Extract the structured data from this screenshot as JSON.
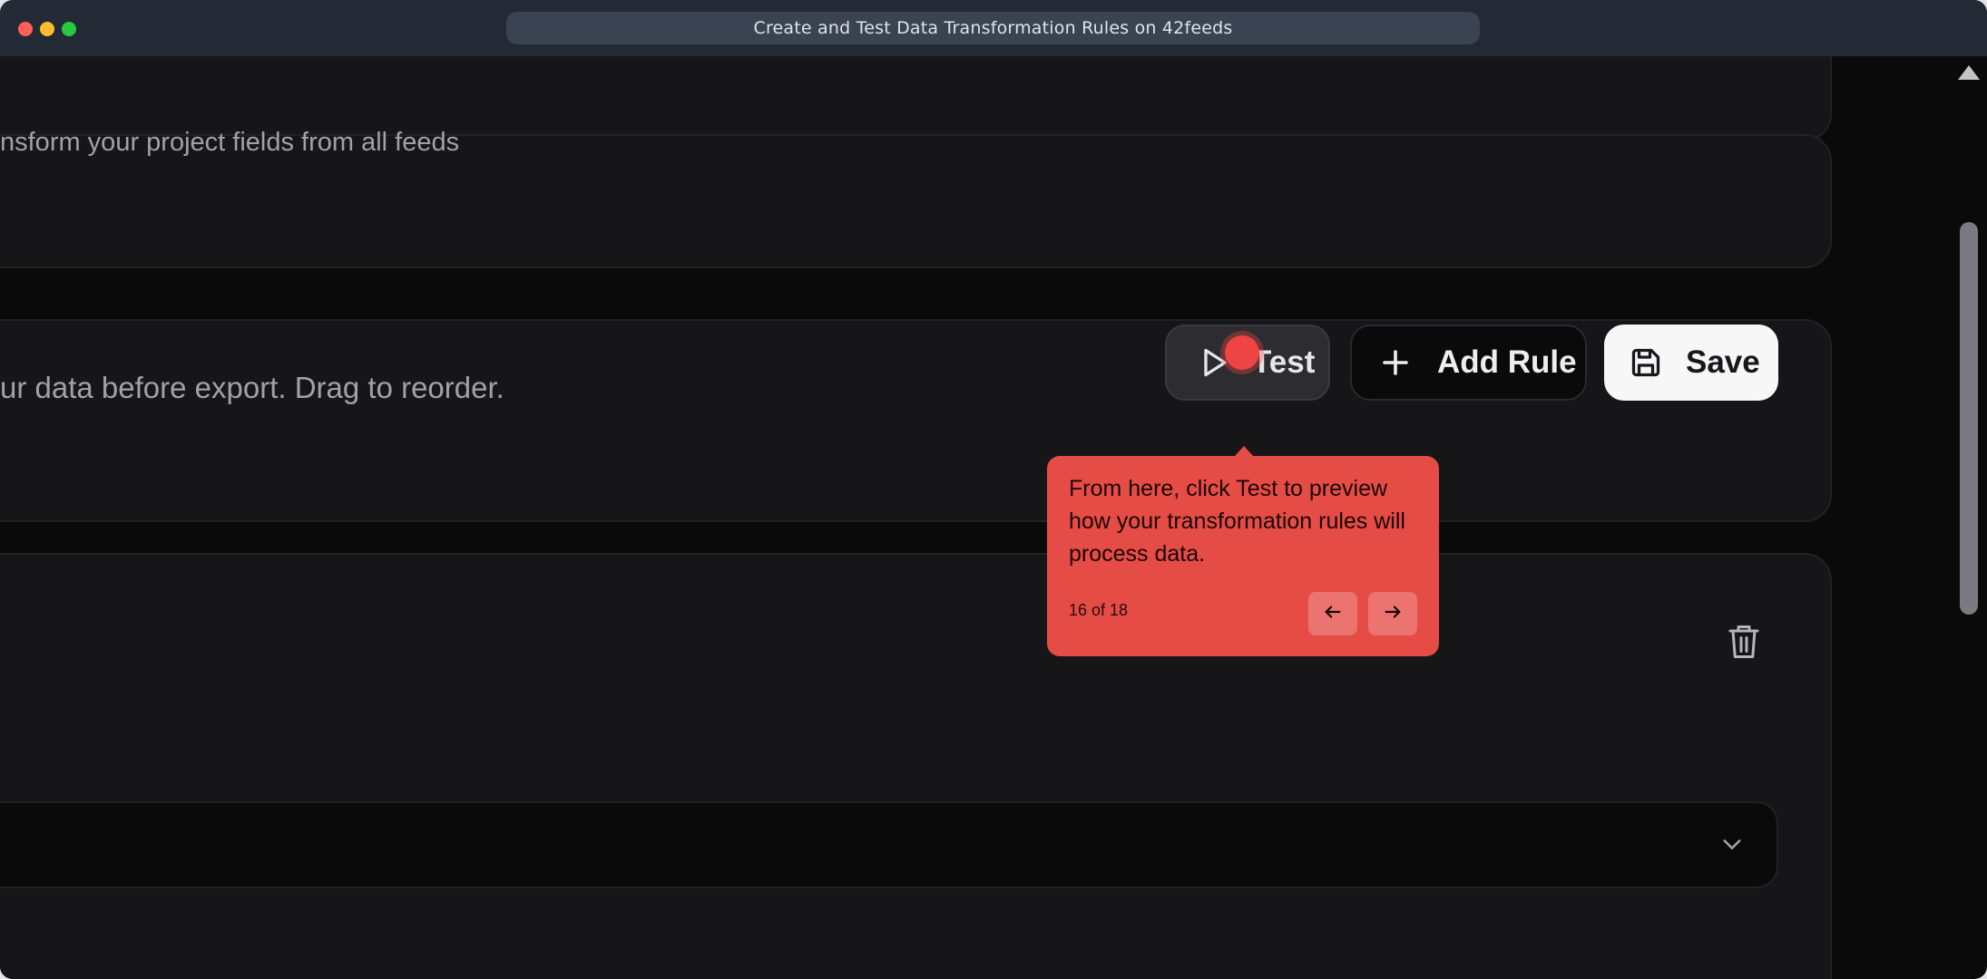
{
  "window": {
    "title": "Create and Test Data Transformation Rules on 42feeds"
  },
  "page": {
    "description_text": "nsform your project fields from all feeds",
    "rules_subtitle": "ur data before export. Drag to reorder."
  },
  "toolbar": {
    "test_label": "Test",
    "add_rule_label": "Add Rule",
    "save_label": "Save"
  },
  "tooltip": {
    "text": "From here, click Test to preview how your transformation rules will process data.",
    "step": "16 of 18"
  },
  "icons": {
    "test": "play-icon",
    "add_rule": "plus-icon",
    "save": "floppy-disk-icon",
    "delete": "trash-icon",
    "dropdown": "chevron-down-icon",
    "prev": "arrow-left-icon",
    "next": "arrow-right-icon"
  },
  "colors": {
    "tooltip_bg": "#e54c46",
    "pulse": "#ef4444",
    "background": "#0a0a0b",
    "card": "#161618"
  }
}
